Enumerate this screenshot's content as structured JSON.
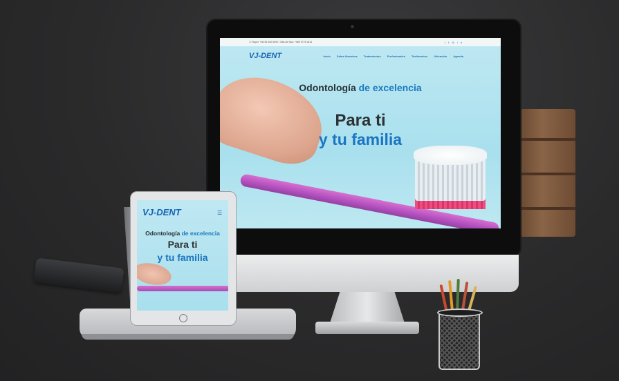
{
  "scene": {
    "background_color": "#2b2b2c"
  },
  "desktop_site": {
    "topbar_text": "Ⓙ Rapel: +56 55 252 5090 / Villa del Mar: +569 9776 4431",
    "social_icons": [
      "twitter-icon",
      "facebook-icon",
      "instagram-icon",
      "linkedin-icon"
    ],
    "logo_text": "VJ-DENT",
    "menu": [
      "Inicio",
      "Sobre Nosotros",
      "Tratamientos",
      "Profesionales",
      "Testimonios",
      "Ubicación",
      "Agenda"
    ],
    "hero_subtitle_plain": "Odontología",
    "hero_subtitle_accent": "de excelencia",
    "hero_title_line1": "Para ti",
    "hero_title_line2": "y tu familia",
    "accent_color": "#1879c3"
  },
  "tablet_site": {
    "logo_text": "VJ-DENT",
    "menu_icon": "hamburger-menu-icon",
    "hero_subtitle_plain": "Odontología",
    "hero_subtitle_accent": "de excelencia",
    "hero_title_line1": "Para ti",
    "hero_title_line2": "y tu familia"
  }
}
